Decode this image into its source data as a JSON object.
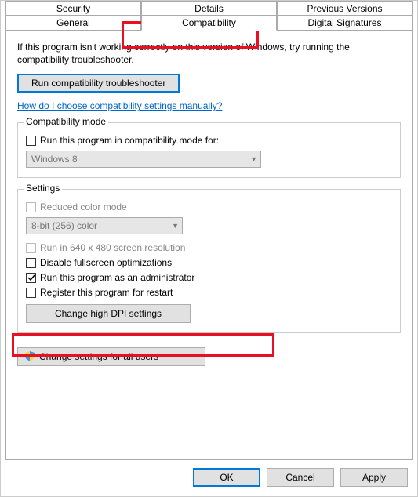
{
  "tabs": {
    "row1": [
      "Security",
      "Details",
      "Previous Versions"
    ],
    "row2": [
      "General",
      "Compatibility",
      "Digital Signatures"
    ],
    "selected": "Compatibility"
  },
  "intro": "If this program isn't working correctly on this version of Windows, try running the compatibility troubleshooter.",
  "troubleshooter_btn": "Run compatibility troubleshooter",
  "manual_link": "How do I choose compatibility settings manually?",
  "compat_group": {
    "title": "Compatibility mode",
    "cb_label": "Run this program in compatibility mode for:",
    "combo": "Windows 8"
  },
  "settings_group": {
    "title": "Settings",
    "reduced_color": "Reduced color mode",
    "color_combo": "8-bit (256) color",
    "run_640": "Run in 640 x 480 screen resolution",
    "disable_fullscreen": "Disable fullscreen optimizations",
    "run_admin": "Run this program as an administrator",
    "register_restart": "Register this program for restart",
    "change_dpi": "Change high DPI settings"
  },
  "change_all_users": "Change settings for all users",
  "footer": {
    "ok": "OK",
    "cancel": "Cancel",
    "apply": "Apply"
  }
}
